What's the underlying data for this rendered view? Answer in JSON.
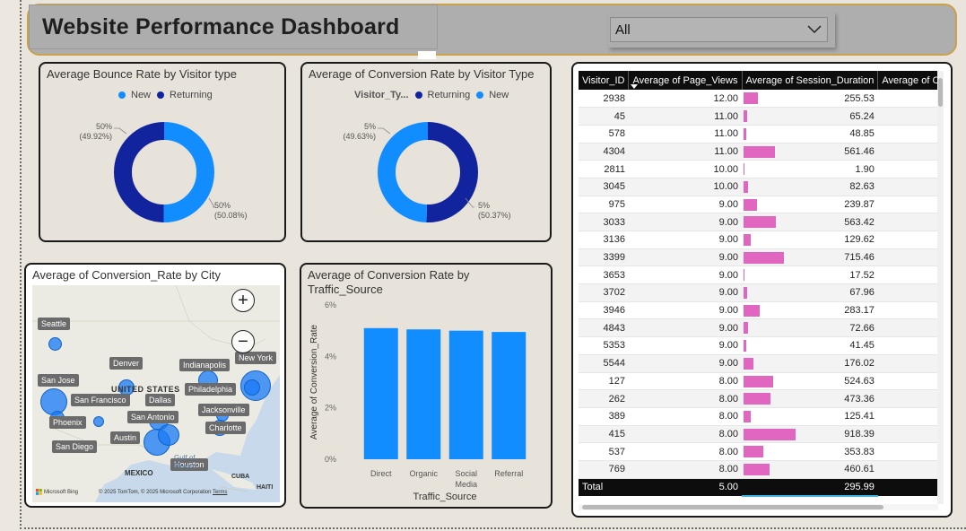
{
  "header": {
    "title": "Website Performance Dashboard",
    "slicer_value": "All"
  },
  "bounce_donut": {
    "title": "Average Bounce Rate by Visitor type",
    "legend": [
      "New",
      "Returning"
    ],
    "colors": {
      "New": "#118dff",
      "Returning": "#12239e"
    },
    "new_pct": 50.08,
    "returning_pct": 49.92,
    "label_left_top": "50%",
    "label_left_bottom": "(49.92%)",
    "label_right_top": "50%",
    "label_right_bottom": "(50.08%)"
  },
  "conversion_donut": {
    "title": "Average of Conversion Rate by Visitor Type",
    "legend_title": "Visitor_Ty...",
    "legend": [
      "Returning",
      "New"
    ],
    "returning_pct": 50.37,
    "new_pct": 49.63,
    "label_left_top": "5%",
    "label_left_bottom": "(49.63%)",
    "label_right_top": "5%",
    "label_right_bottom": "(50.37%)"
  },
  "map": {
    "title": "Average of Conversion_Rate by City",
    "cities": [
      "Seattle",
      "Denver",
      "Indianapolis",
      "New York",
      "San Jose",
      "San Francisco",
      "Dallas",
      "Philadelphia",
      "Phoenix",
      "San Antonio",
      "Jacksonville",
      "Austin",
      "Charlotte",
      "San Diego",
      "Houston"
    ],
    "country_label": "UNITED STATES",
    "mexico_label": "MEXICO",
    "cuba_label": "CUBA",
    "haiti_label": "HAITI",
    "gulf_label": "Gulf of",
    "gulf_label2": "Mexico",
    "zoom_in": "+",
    "zoom_out": "−",
    "attribution": "© 2025 TomTom, © 2025 Microsoft Corporation",
    "terms": "Terms",
    "bing": "Microsoft Bing"
  },
  "chart_data": {
    "type": "bar",
    "title": "Average of Conversion Rate by Traffic_Source",
    "title_line1": "Average of Conversion Rate by",
    "title_line2": "Traffic_Source",
    "categories": [
      "Direct",
      "Organic",
      "Social Media",
      "Referral"
    ],
    "category_line1": [
      "Direct",
      "Organic",
      "Social",
      "Referral"
    ],
    "category_line2": [
      "",
      "",
      "Media",
      ""
    ],
    "values": [
      5.1,
      5.05,
      5.0,
      4.95
    ],
    "ylim": [
      0,
      6
    ],
    "yticks": [
      "0%",
      "2%",
      "4%",
      "6%"
    ],
    "ytick_values": [
      0,
      2,
      4,
      6
    ],
    "xlabel": "Traffic_Source",
    "ylabel": "Average of Conversion_Rate",
    "bar_color": "#118dff",
    "grid": false
  },
  "table": {
    "columns": [
      "Visitor_ID",
      "Average of Page_Views",
      "Average of Session_Duration",
      "Average of Con"
    ],
    "bar_color": "#e066c0",
    "max_session": 918.39,
    "rows": [
      {
        "id": "2938",
        "pv": "12.00",
        "sd": 255.53,
        "sd_text": "255.53"
      },
      {
        "id": "45",
        "pv": "11.00",
        "sd": 65.24,
        "sd_text": "65.24"
      },
      {
        "id": "578",
        "pv": "11.00",
        "sd": 48.85,
        "sd_text": "48.85"
      },
      {
        "id": "4304",
        "pv": "11.00",
        "sd": 561.46,
        "sd_text": "561.46"
      },
      {
        "id": "2811",
        "pv": "10.00",
        "sd": 1.9,
        "sd_text": "1.90"
      },
      {
        "id": "3045",
        "pv": "10.00",
        "sd": 82.63,
        "sd_text": "82.63"
      },
      {
        "id": "975",
        "pv": "9.00",
        "sd": 239.87,
        "sd_text": "239.87"
      },
      {
        "id": "3033",
        "pv": "9.00",
        "sd": 563.42,
        "sd_text": "563.42"
      },
      {
        "id": "3136",
        "pv": "9.00",
        "sd": 129.62,
        "sd_text": "129.62"
      },
      {
        "id": "3399",
        "pv": "9.00",
        "sd": 715.46,
        "sd_text": "715.46"
      },
      {
        "id": "3653",
        "pv": "9.00",
        "sd": 17.52,
        "sd_text": "17.52"
      },
      {
        "id": "3702",
        "pv": "9.00",
        "sd": 67.96,
        "sd_text": "67.96"
      },
      {
        "id": "3946",
        "pv": "9.00",
        "sd": 283.17,
        "sd_text": "283.17"
      },
      {
        "id": "4843",
        "pv": "9.00",
        "sd": 72.66,
        "sd_text": "72.66"
      },
      {
        "id": "5353",
        "pv": "9.00",
        "sd": 41.45,
        "sd_text": "41.45"
      },
      {
        "id": "5544",
        "pv": "9.00",
        "sd": 176.02,
        "sd_text": "176.02"
      },
      {
        "id": "127",
        "pv": "8.00",
        "sd": 524.63,
        "sd_text": "524.63"
      },
      {
        "id": "262",
        "pv": "8.00",
        "sd": 473.36,
        "sd_text": "473.36"
      },
      {
        "id": "389",
        "pv": "8.00",
        "sd": 125.41,
        "sd_text": "125.41"
      },
      {
        "id": "415",
        "pv": "8.00",
        "sd": 918.39,
        "sd_text": "918.39"
      },
      {
        "id": "537",
        "pv": "8.00",
        "sd": 353.83,
        "sd_text": "353.83"
      },
      {
        "id": "769",
        "pv": "8.00",
        "sd": 460.61,
        "sd_text": "460.61"
      }
    ],
    "total_label": "Total",
    "total_pv": "5.00",
    "total_sd": "295.99"
  }
}
